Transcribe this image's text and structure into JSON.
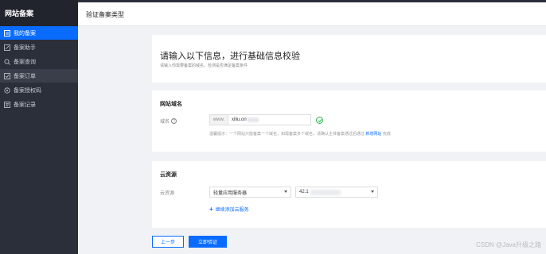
{
  "sidebar": {
    "brand": "网站备案",
    "items": [
      {
        "label": "我的备案",
        "icon": "list-icon",
        "active": true
      },
      {
        "label": "备案助手",
        "icon": "edit-icon"
      },
      {
        "label": "备案查询",
        "icon": "search-icon"
      },
      {
        "label": "备案订单",
        "icon": "order-icon"
      },
      {
        "label": "备案授权码",
        "icon": "key-icon"
      },
      {
        "label": "备案记录",
        "icon": "record-icon"
      }
    ]
  },
  "header": {
    "title": "验证备案类型"
  },
  "intro": {
    "heading": "请输入以下信息，进行基础信息校验",
    "subtext": "请输入你需要备案的域名，检测是否满足备案条件"
  },
  "domain_section": {
    "title": "网站域名",
    "field_label": "域名",
    "prefix": "www.",
    "value": "xiliu.on",
    "tip_prefix": "温馨提示：一个网站只能备案一个域名，如需备案多个域名，请确认主体备案通过后通过",
    "tip_link": "新增网站",
    "tip_suffix": "完成"
  },
  "cloud_section": {
    "title": "云资源",
    "field_label": "云资源",
    "select1_value": "轻量应用服务器",
    "select2_value": "42.1",
    "add_link": "继续添加云服务"
  },
  "buttons": {
    "prev": "上一步",
    "verify": "立即验证"
  },
  "watermark": "CSDN @Java升级之路",
  "colors": {
    "accent": "#0a6cff",
    "sidebar": "#2b2f3a",
    "success": "#2bb24c"
  }
}
